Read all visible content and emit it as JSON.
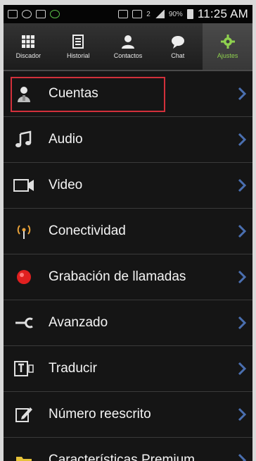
{
  "status_bar": {
    "battery_pct": "90%",
    "time": "11:25 AM",
    "sim_label": "2"
  },
  "tabs": [
    {
      "label": "Discador",
      "icon": "dialpad-icon",
      "active": false
    },
    {
      "label": "Historial",
      "icon": "history-icon",
      "active": false
    },
    {
      "label": "Contactos",
      "icon": "contacts-icon",
      "active": false
    },
    {
      "label": "Chat",
      "icon": "chat-icon",
      "active": false
    },
    {
      "label": "Ajustes",
      "icon": "gear-icon",
      "active": true
    }
  ],
  "settings": [
    {
      "label": "Cuentas",
      "icon": "accounts-icon",
      "highlighted": true
    },
    {
      "label": "Audio",
      "icon": "music-note-icon"
    },
    {
      "label": "Video",
      "icon": "video-camera-icon"
    },
    {
      "label": "Conectividad",
      "icon": "antenna-icon"
    },
    {
      "label": "Grabación de llamadas",
      "icon": "record-icon"
    },
    {
      "label": "Avanzado",
      "icon": "wrench-icon"
    },
    {
      "label": "Traducir",
      "icon": "translate-icon"
    },
    {
      "label": "Número reescrito",
      "icon": "edit-icon"
    },
    {
      "label": "Características Premium",
      "icon": "folder-icon"
    }
  ],
  "colors": {
    "active_tab": "#8fd14f",
    "highlight_border": "#d2303b",
    "record_dot": "#e02020",
    "antenna": "#e8a23a"
  }
}
